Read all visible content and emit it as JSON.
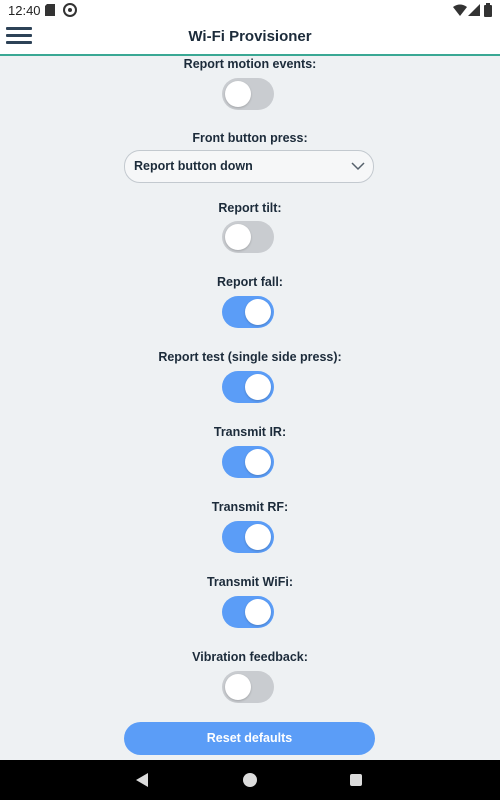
{
  "status_bar": {
    "time": "12:40"
  },
  "app_bar": {
    "title": "Wi-Fi Provisioner"
  },
  "colors": {
    "accent": "#5b9df7",
    "header_underline": "#3aa894",
    "toggle_off": "#c9ccd0",
    "background": "#eef1f3"
  },
  "settings": {
    "report_motion_events": {
      "label": "Report motion events:",
      "enabled": false
    },
    "front_button_press": {
      "label": "Front button press:",
      "selected": "Report button down"
    },
    "report_tilt": {
      "label": "Report tilt:",
      "enabled": false
    },
    "report_fall": {
      "label": "Report fall:",
      "enabled": true
    },
    "report_test": {
      "label": "Report test (single side press):",
      "enabled": true
    },
    "transmit_ir": {
      "label": "Transmit IR:",
      "enabled": true
    },
    "transmit_rf": {
      "label": "Transmit RF:",
      "enabled": true
    },
    "transmit_wifi": {
      "label": "Transmit WiFi:",
      "enabled": true
    },
    "vibration_feedback": {
      "label": "Vibration feedback:",
      "enabled": false
    }
  },
  "reset_button": {
    "label": "Reset defaults"
  },
  "nav_bar": {
    "icons": [
      "back-icon",
      "home-icon",
      "recents-icon"
    ]
  }
}
